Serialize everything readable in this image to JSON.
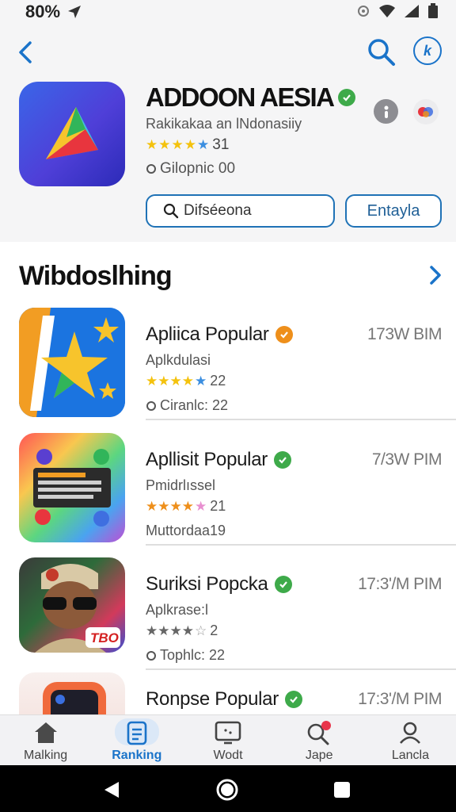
{
  "status_bar": {
    "battery_text": "80%"
  },
  "header": {
    "back_icon": "chevron-left-icon",
    "search_icon": "search-icon",
    "badge_text": "k"
  },
  "hero": {
    "title": "ADDOON AESIA",
    "subtitle": "Rakikakaa an lNdonasiiy",
    "rating": "31",
    "meta": "Gilopnic 00",
    "search_label": "Difséeona",
    "action_label": "Entayla"
  },
  "section": {
    "title": "Wibdoslhing"
  },
  "apps": [
    {
      "name": "Apliica Popular",
      "time": "173W BIM",
      "subtitle": "Aplkdulasi",
      "rating": "22",
      "meta": "Ciranlc: 22",
      "badge": "orange"
    },
    {
      "name": "Apllisit Popular",
      "time": "7/3W PIM",
      "subtitle": "Pmidrlıssel",
      "rating": "21",
      "meta": "Muttordaa19",
      "badge": "green"
    },
    {
      "name": "Suriksi Popcka",
      "time": "17:3'/M PIM",
      "subtitle": "Aplkrase:l",
      "rating": "2",
      "meta": "Tophlc: 22",
      "badge": "green"
    },
    {
      "name": "Ronpse Popular",
      "time": "17:3'/M PIM",
      "subtitle": "",
      "rating": "",
      "meta": "",
      "badge": "green"
    }
  ],
  "app_icon_text": {
    "third_badge": "TBO"
  },
  "bottom_nav": [
    {
      "label": "Malking",
      "icon": "home-icon"
    },
    {
      "label": "Ranking",
      "icon": "ranking-icon",
      "active": true
    },
    {
      "label": "Wodt",
      "icon": "monitor-icon"
    },
    {
      "label": "Jape",
      "icon": "search-notification-icon"
    },
    {
      "label": "Lancla",
      "icon": "user-icon"
    }
  ],
  "colors": {
    "accent": "#1a73c9",
    "verified": "#3eaa4a",
    "star": "#f4c20d"
  }
}
